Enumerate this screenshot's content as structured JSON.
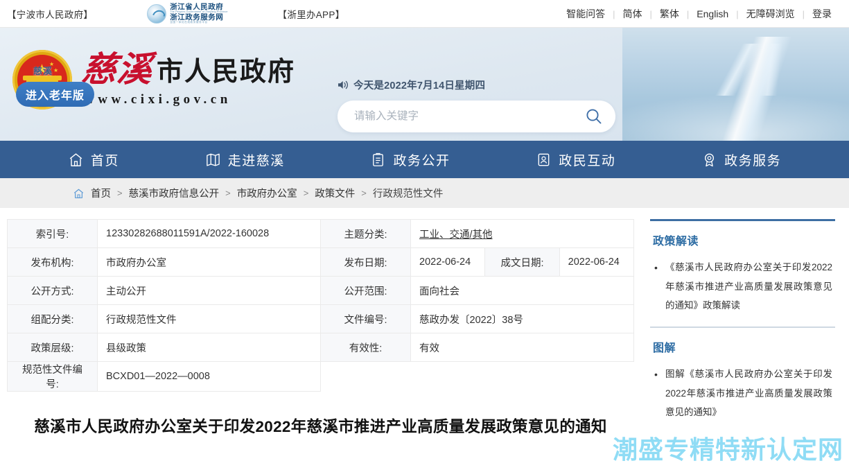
{
  "topbar": {
    "left_links": [
      "【宁波市人民政府】"
    ],
    "zj_logo": {
      "line1": "浙江省人民政府",
      "line1_sub": "The Peoples Government of Zhejiang Province",
      "line2": "浙江政务服务网",
      "line2_sub": "全国一体化在线政务服务平台"
    },
    "app_link": "【浙里办APP】",
    "right_links": [
      "智能问答",
      "简体",
      "繁体",
      "English",
      "无障碍浏览",
      "登录"
    ],
    "separator": "|"
  },
  "header": {
    "logo": {
      "cixi": "慈溪",
      "rest": "市人民政府",
      "url": "www.cixi.gov.cn"
    },
    "today": "今天是2022年7月14日星期四",
    "speaker_icon": "speaker-icon",
    "search": {
      "placeholder": "请输入关键字",
      "value": "",
      "icon": "search-icon"
    },
    "banner": {
      "watermark": "慈溪",
      "senior_button": "进入老年版"
    }
  },
  "nav": {
    "items": [
      {
        "label": "首页",
        "icon": "home-icon"
      },
      {
        "label": "走进慈溪",
        "icon": "map-icon"
      },
      {
        "label": "政务公开",
        "icon": "clipboard-icon"
      },
      {
        "label": "政民互动",
        "icon": "user-card-icon"
      },
      {
        "label": "政务服务",
        "icon": "badge-icon"
      }
    ],
    "background": "#355E92"
  },
  "breadcrumb": {
    "home_icon": "home-icon",
    "items": [
      "首页",
      "慈溪市政府信息公开",
      "市政府办公室",
      "政策文件",
      "行政规范性文件"
    ],
    "separator": ">"
  },
  "meta_table": {
    "rows": [
      {
        "left_label": "索引号:",
        "left_value": "12330282688011591A/2022-160028",
        "right_label": "主题分类:",
        "right_value": "工业、交通/其他",
        "right_value_link": true
      },
      {
        "left_label": "发布机构:",
        "left_value": "市政府办公室",
        "right_label": "发布日期:",
        "right_value": "2022-06-24",
        "extra_label": "成文日期:",
        "extra_value": "2022-06-24"
      },
      {
        "left_label": "公开方式:",
        "left_value": "主动公开",
        "right_label": "公开范围:",
        "right_value": "面向社会"
      },
      {
        "left_label": "组配分类:",
        "left_value": "行政规范性文件",
        "right_label": "文件编号:",
        "right_value": "慈政办发〔2022〕38号"
      },
      {
        "left_label": "政策层级:",
        "left_value": "县级政策",
        "right_label": "有效性:",
        "right_value": "有效"
      },
      {
        "left_label": "规范性文件编号:",
        "left_value": "BCXD01—2022—0008"
      }
    ]
  },
  "document": {
    "title": "慈溪市人民政府办公室关于印发2022年慈溪市推进产业高质量发展政策意见的通知"
  },
  "sidebar": {
    "sections": [
      {
        "heading": "政策解读",
        "items": [
          "《慈溪市人民政府办公室关于印发2022年慈溪市推进产业高质量发展政策意见的通知》政策解读"
        ]
      },
      {
        "heading": "图解",
        "items": [
          "图解《慈溪市人民政府办公室关于印发2022年慈溪市推进产业高质量发展政策意见的通知》"
        ]
      }
    ]
  },
  "watermark": {
    "text": "潮盛专精特新认定网",
    "color": "#8fdcf5"
  }
}
